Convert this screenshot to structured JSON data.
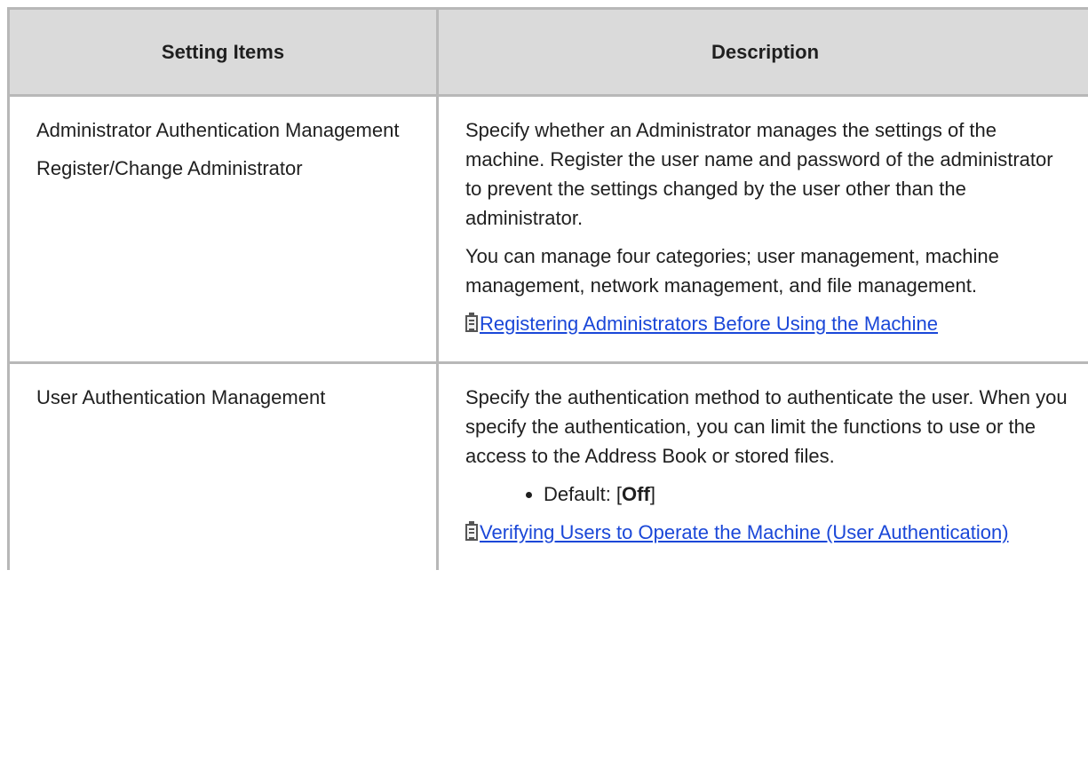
{
  "table": {
    "headers": {
      "items": "Setting Items",
      "description": "Description"
    },
    "rows": [
      {
        "items": [
          "Administrator Authentication Management",
          "Register/Change Administrator"
        ],
        "description": {
          "paragraphs": [
            "Specify whether an Administrator manages the settings of the machine. Register the user name and password of the administrator to prevent the settings changed by the user other than the administrator.",
            "You can manage four categories; user management, machine management, network management, and file management."
          ],
          "link": {
            "icon": "reference-icon",
            "text": "Registering Administrators Before Using the Machine"
          }
        }
      },
      {
        "items": [
          "User Authentication Management"
        ],
        "description": {
          "paragraphs": [
            "Specify the authentication method to authenticate the user. When you specify the authentication, you can limit the functions to use or the access to the Address Book or stored files."
          ],
          "default": {
            "label": "Default: [",
            "value": "Off",
            "suffix": "]"
          },
          "link": {
            "icon": "reference-icon",
            "text": "Verifying Users to Operate the Machine (User Authentication)"
          }
        }
      }
    ]
  },
  "colors": {
    "header_background": "#dadada",
    "border": "#b8b8b8",
    "link": "#1a47d8"
  }
}
